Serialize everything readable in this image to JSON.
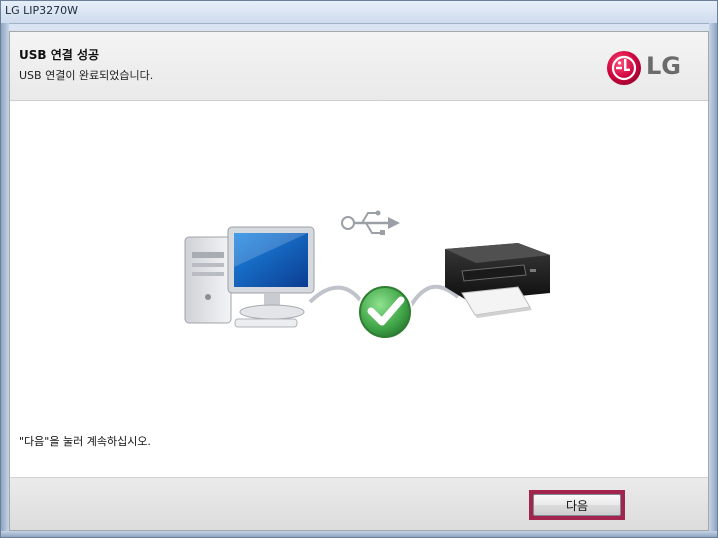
{
  "window": {
    "title": "LG LIP3270W"
  },
  "header": {
    "title": "USB 연결 성공",
    "subtitle": "USB 연결이 완료되었습니다.",
    "logo_text": "LG",
    "logo_color": "#c6003d"
  },
  "content": {
    "instruction": "\"다음\"을 눌러 계속하십시오.",
    "illustration": {
      "left_icon": "computer-icon",
      "middle_icons": [
        "usb-icon",
        "checkmark-icon"
      ],
      "right_icon": "printer-icon",
      "status_color": "#4caf50"
    }
  },
  "footer": {
    "next_label": "다음"
  }
}
